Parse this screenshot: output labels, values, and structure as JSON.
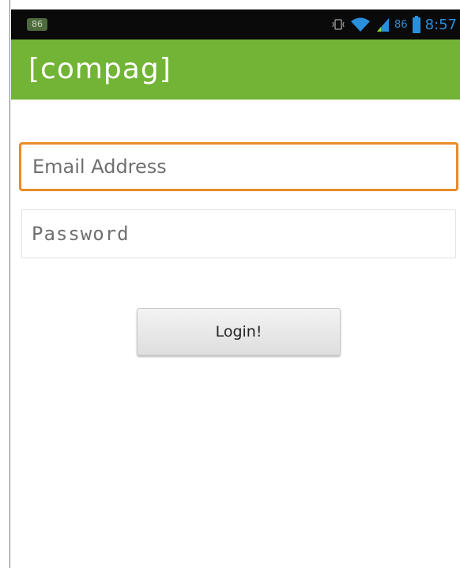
{
  "status_bar": {
    "notification_badge": "86",
    "battery_level": "86",
    "time": "8:57",
    "icons": [
      "vibrate-icon",
      "wifi-icon",
      "signal-icon",
      "battery-icon"
    ],
    "accent_color": "#2a8fdb"
  },
  "app_bar": {
    "title": "[compag]",
    "background_color": "#72b435"
  },
  "login_form": {
    "email_placeholder": "Email Address",
    "email_value": "",
    "email_focus_color": "#e88b2c",
    "password_placeholder": "Password",
    "password_value": "",
    "login_button_label": "Login!"
  }
}
